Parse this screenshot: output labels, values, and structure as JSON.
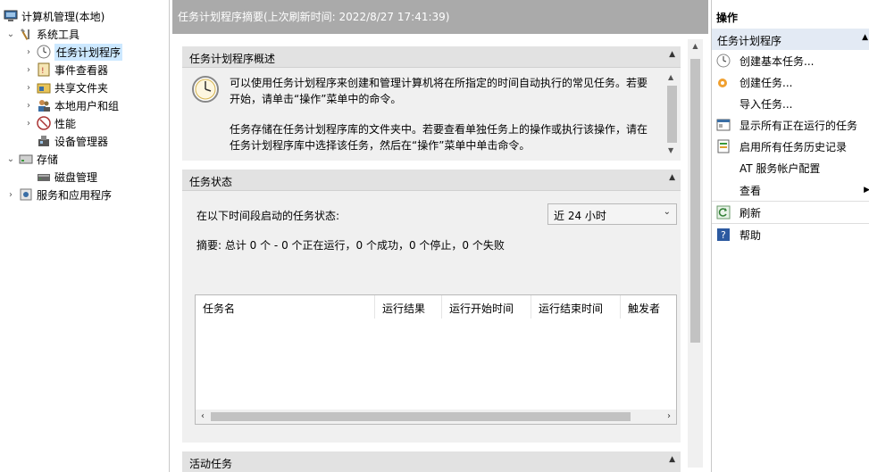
{
  "tree": {
    "root": "计算机管理(本地)",
    "system_tools": "系统工具",
    "task_scheduler": "任务计划程序",
    "event_viewer": "事件查看器",
    "shared_folders": "共享文件夹",
    "local_users": "本地用户和组",
    "performance": "性能",
    "device_manager": "设备管理器",
    "storage": "存储",
    "disk_management": "磁盘管理",
    "services_apps": "服务和应用程序"
  },
  "center": {
    "header": "任务计划程序摘要(上次刷新时间: 2022/8/27 17:41:39)",
    "overview": {
      "title": "任务计划程序概述",
      "para1_line1": "可以使用任务计划程序来创建和管理计算机将在所指定的时间自动执行的常见任务。若要",
      "para1_line2": "开始，请单击“操作”菜单中的命令。",
      "para2_line1": "任务存储在任务计划程序库的文件夹中。若要查看单独任务上的操作或执行该操作，请在",
      "para2_line2": "任务计划程序库中选择该任务，然后在“操作”菜单中单击命令。"
    },
    "status": {
      "title": "任务状态",
      "period_label": "在以下时间段启动的任务状态:",
      "period_value": "近 24 小时",
      "summary": "摘要: 总计 0 个 - 0 个正在运行，0 个成功，0 个停止，0 个失败",
      "columns": [
        "任务名",
        "运行结果",
        "运行开始时间",
        "运行结束时间",
        "触发者"
      ]
    },
    "active": {
      "title": "活动任务"
    }
  },
  "actions": {
    "header": "操作",
    "section": "任务计划程序",
    "items": [
      "创建基本任务...",
      "创建任务...",
      "导入任务...",
      "显示所有正在运行的任务",
      "启用所有任务历史记录",
      "AT 服务帐户配置",
      "查看",
      "刷新",
      "帮助"
    ]
  },
  "colors": {
    "header_gray": "#aaaaaa",
    "panel_bg": "#f0f0f0",
    "panel_header": "#e2e2e2",
    "selection": "#cce8ff",
    "action_section": "#e3eaf4"
  }
}
